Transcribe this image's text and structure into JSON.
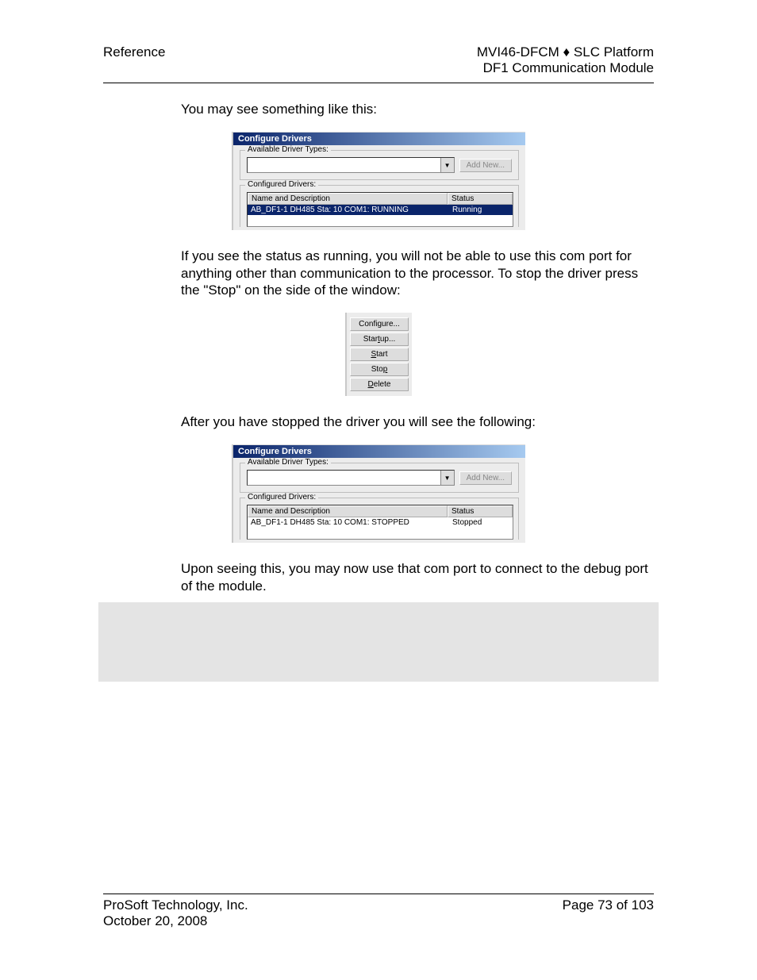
{
  "header": {
    "left": "Reference",
    "right_line1": "MVI46-DFCM ♦ SLC Platform",
    "right_line2": "DF1 Communication Module"
  },
  "para1": "You may see something like this:",
  "dlg1": {
    "title": "Configure Drivers",
    "available_legend": "Available Driver Types:",
    "addnew": "Add New...",
    "configured_legend": "Configured Drivers:",
    "col_name": "Name and Description",
    "col_status": "Status",
    "row_name": "AB_DF1-1 DH485 Sta: 10 COM1: RUNNING",
    "row_status": "Running"
  },
  "para2": "If you see the status as running, you will not be able to use this com port for anything other than communication to the processor. To stop the driver press the \"Stop\" on the side of the window:",
  "panel": {
    "configure": "Configure...",
    "startup": "Startup...",
    "start": "Start",
    "stop": "Stop",
    "delete": "Delete"
  },
  "para3": "After you have stopped the driver you will see the following:",
  "dlg2": {
    "title": "Configure Drivers",
    "available_legend": "Available Driver Types:",
    "addnew": "Add New...",
    "configured_legend": "Configured Drivers:",
    "col_name": "Name and Description",
    "col_status": "Status",
    "row_name": "AB_DF1-1 DH485 Sta: 10 COM1: STOPPED",
    "row_status": "Stopped"
  },
  "para4": "Upon seeing this, you may now use that com port to connect to the debug port of the module.",
  "footer": {
    "left_line1": "ProSoft Technology, Inc.",
    "left_line2": "October 20, 2008",
    "right": "Page 73 of 103"
  }
}
